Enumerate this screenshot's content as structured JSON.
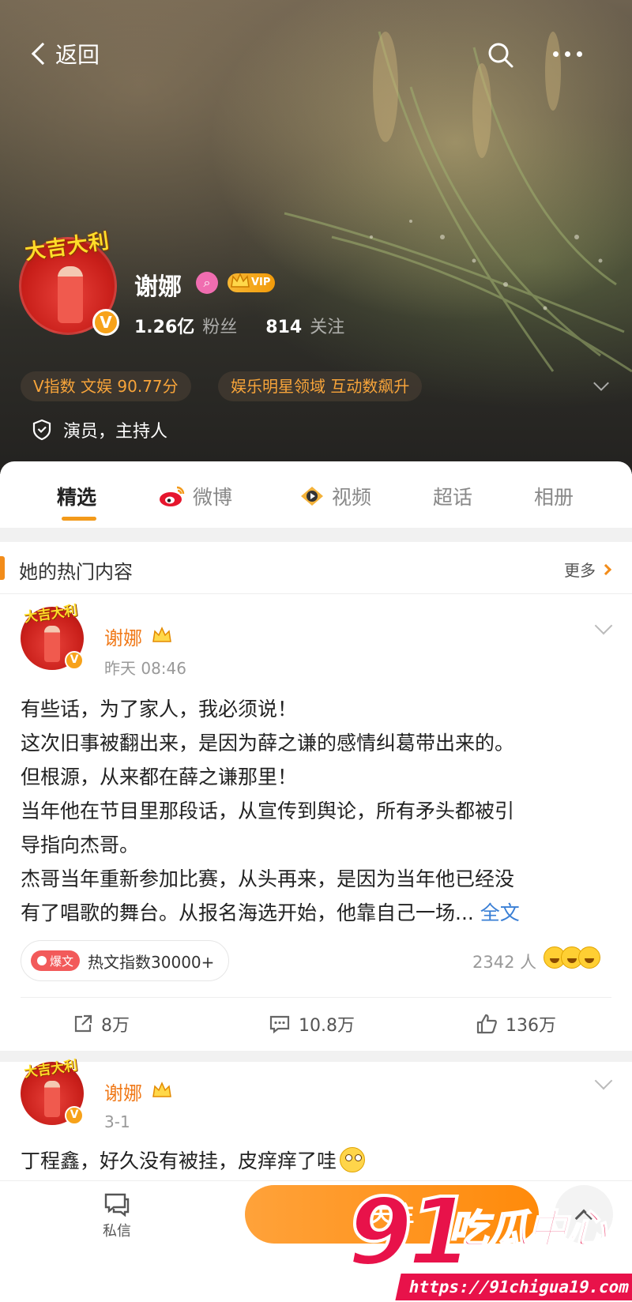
{
  "header": {
    "back_label": "返回"
  },
  "profile": {
    "name": "谢娜",
    "avatar_banner": "大吉大利",
    "vip_label": "VIP",
    "fans_count": "1.26亿",
    "fans_label": "粉丝",
    "following_count": "814",
    "following_label": "关注",
    "tags": [
      "V指数 文娱 90.77分",
      "娱乐明星领域 互动数飙升"
    ],
    "occupation": "演员，主持人"
  },
  "tabs": [
    {
      "label": "精选",
      "active": true
    },
    {
      "label": "微博",
      "active": false
    },
    {
      "label": "视频",
      "active": false
    },
    {
      "label": "超话",
      "active": false
    },
    {
      "label": "相册",
      "active": false
    }
  ],
  "hot_section": {
    "title": "她的热门内容",
    "more_label": "更多"
  },
  "posts": [
    {
      "author": "谢娜",
      "time": "昨天 08:46",
      "lines": [
        "有些话，为了家人，我必须说！",
        "这次旧事被翻出来，是因为薛之谦的感情纠葛带出来的。",
        "但根源，从来都在薛之谦那里！",
        "当年他在节目里那段话，从宣传到舆论，所有矛头都被引",
        "导指向杰哥。",
        "杰哥当年重新参加比赛，从头再来，是因为当年他已经没",
        "有了唱歌的舞台。从报名海选开始，他靠自己一场..."
      ],
      "full_text_label": "全文",
      "hot_badge": "爆文",
      "hot_index": "热文指数30000+",
      "reaction_count": "2342 人",
      "reposts": "8万",
      "comments": "10.8万",
      "likes": "136万"
    },
    {
      "author": "谢娜",
      "time": "3-1",
      "text": "丁程鑫，好久没有被挂，皮痒痒了哇"
    }
  ],
  "bottom_bar": {
    "dm_label": "私信",
    "follow_label": "关注"
  },
  "watermark": {
    "number": "91",
    "text": "吃瓜中心",
    "url": "https://91chigua19.com"
  },
  "colors": {
    "accent": "#f39a1a",
    "name_orange": "#f07a1a",
    "link_blue": "#3a7fd5",
    "watermark_red": "#e8124a"
  }
}
